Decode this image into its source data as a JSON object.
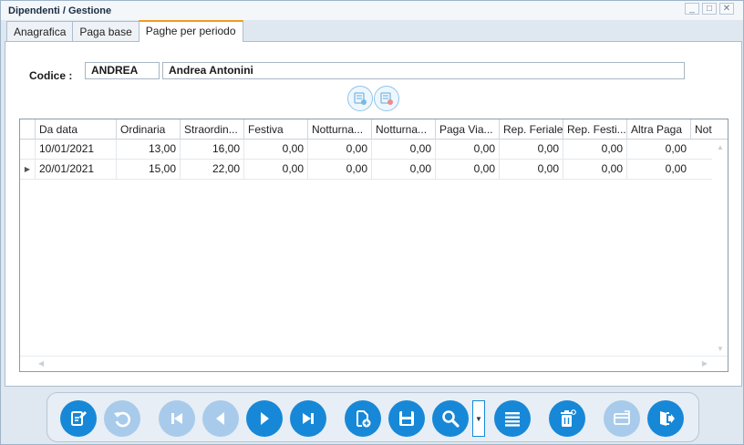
{
  "window": {
    "title": "Dipendenti / Gestione",
    "minimize": "_",
    "maximize": "□",
    "close": "✕"
  },
  "tabs": [
    {
      "label": "Anagrafica",
      "active": false
    },
    {
      "label": "Paga base",
      "active": false
    },
    {
      "label": "Paghe per periodo",
      "active": true
    }
  ],
  "employee": {
    "code_label": "Codice :",
    "code": "ANDREA",
    "name": "Andrea Antonini"
  },
  "grid": {
    "columns": [
      "Da data",
      "Ordinaria",
      "Straordin...",
      "Festiva",
      "Notturna...",
      "Notturna...",
      "Paga Via...",
      "Rep. Feriale",
      "Rep. Festi...",
      "Altra Paga",
      "Not"
    ],
    "rows": [
      {
        "current": false,
        "cells": [
          "10/01/2021",
          "13,00",
          "16,00",
          "0,00",
          "0,00",
          "0,00",
          "0,00",
          "0,00",
          "0,00",
          "0,00"
        ]
      },
      {
        "current": true,
        "cells": [
          "20/01/2021",
          "15,00",
          "22,00",
          "0,00",
          "0,00",
          "0,00",
          "0,00",
          "0,00",
          "0,00",
          "0,00"
        ]
      }
    ]
  },
  "toolbar": {
    "accent": "#1788d7",
    "disabled_color": "#a8cbeb",
    "buttons": [
      {
        "icon": "edit-document-icon",
        "enabled": true
      },
      {
        "icon": "undo-icon",
        "enabled": false
      },
      {
        "icon": "first-record-icon",
        "enabled": false
      },
      {
        "icon": "previous-record-icon",
        "enabled": false
      },
      {
        "icon": "next-record-icon",
        "enabled": true
      },
      {
        "icon": "last-record-icon",
        "enabled": true
      },
      {
        "icon": "new-document-icon",
        "enabled": true
      },
      {
        "icon": "save-icon",
        "enabled": true
      },
      {
        "icon": "search-icon",
        "enabled": true
      },
      {
        "icon": "list-icon",
        "enabled": true
      },
      {
        "icon": "delete-icon",
        "enabled": true
      },
      {
        "icon": "card-icon",
        "enabled": false
      },
      {
        "icon": "exit-icon",
        "enabled": true
      }
    ]
  }
}
